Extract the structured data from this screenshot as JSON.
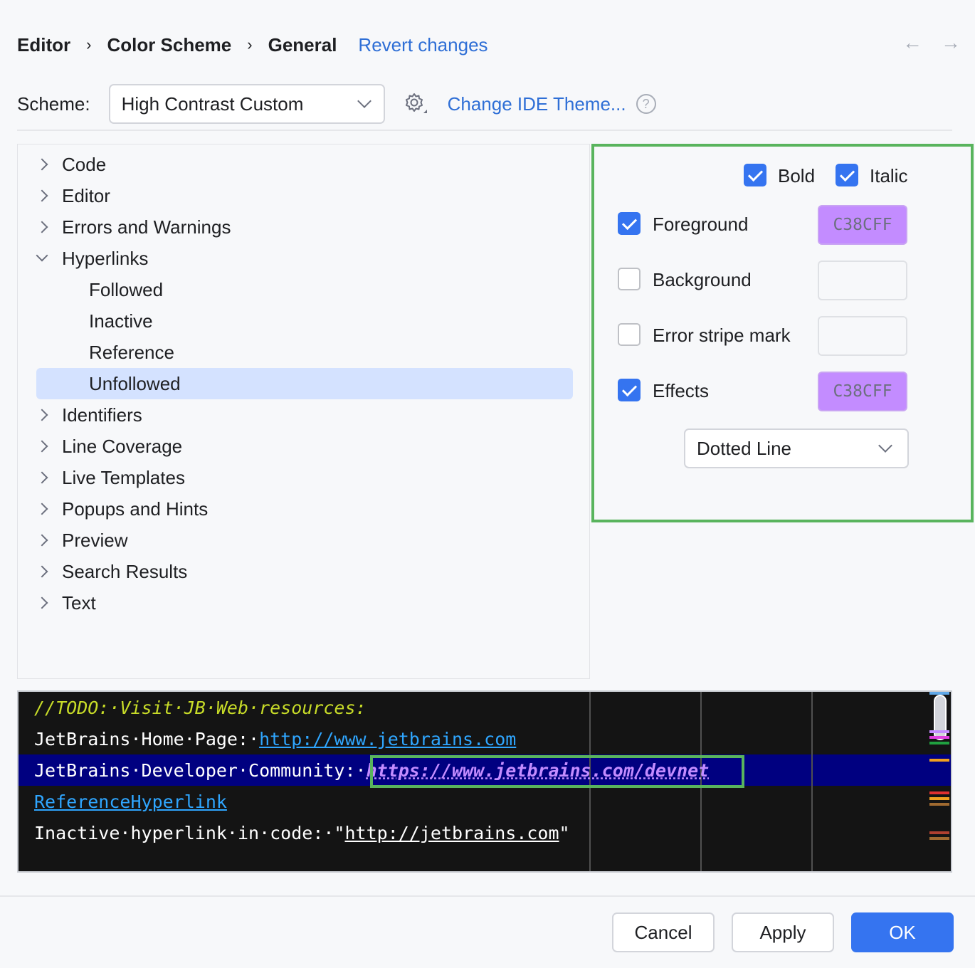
{
  "breadcrumb": {
    "items": [
      "Editor",
      "Color Scheme",
      "General"
    ],
    "separator": "›",
    "revert_label": "Revert changes"
  },
  "nav": {
    "back": "←",
    "forward": "→"
  },
  "scheme": {
    "label": "Scheme:",
    "value": "High Contrast Custom",
    "change_theme_label": "Change IDE Theme...",
    "help": "?"
  },
  "tree": {
    "items": [
      {
        "label": "Code",
        "expandable": true
      },
      {
        "label": "Editor",
        "expandable": true
      },
      {
        "label": "Errors and Warnings",
        "expandable": true
      },
      {
        "label": "Hyperlinks",
        "expandable": true,
        "expanded": true
      },
      {
        "label": "Followed",
        "child": true
      },
      {
        "label": "Inactive",
        "child": true
      },
      {
        "label": "Reference",
        "child": true
      },
      {
        "label": "Unfollowed",
        "child": true,
        "selected": true
      },
      {
        "label": "Identifiers",
        "expandable": true
      },
      {
        "label": "Line Coverage",
        "expandable": true
      },
      {
        "label": "Live Templates",
        "expandable": true
      },
      {
        "label": "Popups and Hints",
        "expandable": true
      },
      {
        "label": "Preview",
        "expandable": true
      },
      {
        "label": "Search Results",
        "expandable": true
      },
      {
        "label": "Text",
        "expandable": true
      }
    ]
  },
  "props": {
    "bold": {
      "label": "Bold",
      "checked": true
    },
    "italic": {
      "label": "Italic",
      "checked": true
    },
    "foreground": {
      "label": "Foreground",
      "checked": true,
      "color": "C38CFF"
    },
    "background": {
      "label": "Background",
      "checked": false,
      "color": ""
    },
    "error_stripe": {
      "label": "Error stripe mark",
      "checked": false,
      "color": ""
    },
    "effects": {
      "label": "Effects",
      "checked": true,
      "color": "C38CFF"
    },
    "effect_type": "Dotted Line"
  },
  "preview": {
    "line1": "//TODO:·Visit·JB·Web·resources:",
    "line2_prefix": "JetBrains·Home·Page:·",
    "line2_link": "http://www.jetbrains.com",
    "line3_prefix": "JetBrains·Developer·Community:·",
    "line3_link": "https://www.jetbrains.com/devnet",
    "line4": "ReferenceHyperlink",
    "line5_prefix": "Inactive·hyperlink·in·code:·\"",
    "line5_link": "http://jetbrains.com",
    "line5_suffix": "\""
  },
  "buttons": {
    "cancel": "Cancel",
    "apply": "Apply",
    "ok": "OK"
  },
  "colors": {
    "accent": "#3574f0",
    "highlight_border": "#59b45d",
    "foreground_swatch": "#c38cff",
    "selection": "#d4e2ff"
  }
}
